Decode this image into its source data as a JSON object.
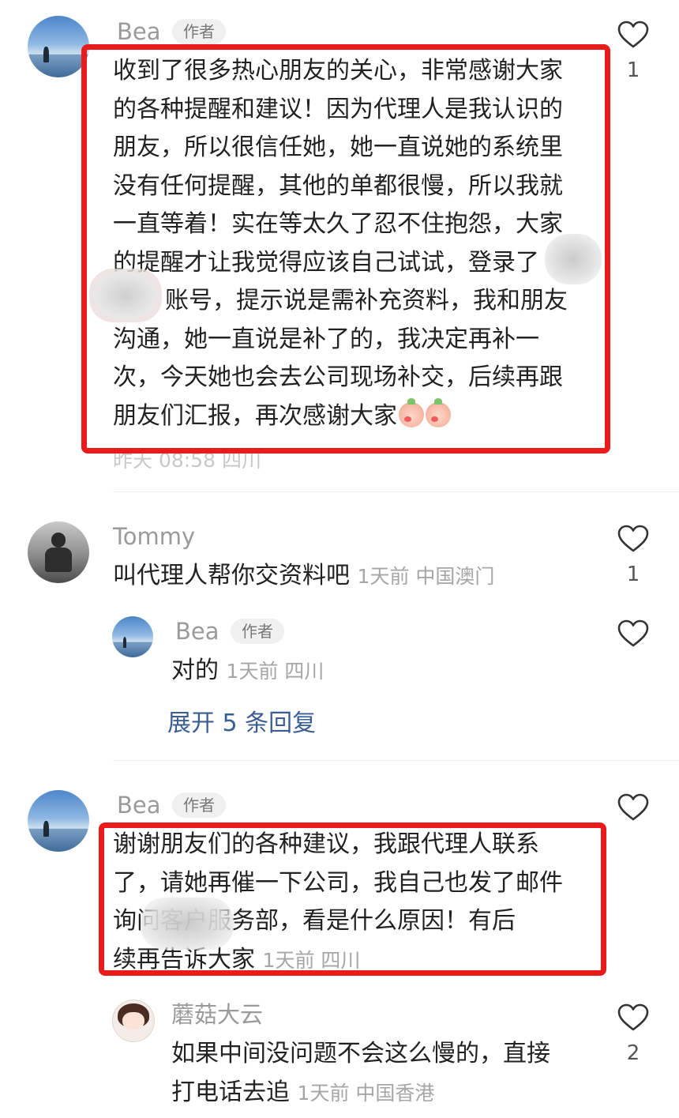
{
  "comments": [
    {
      "user": "Bea",
      "tag": "作者",
      "lines": [
        "收到了很多热心朋友的关心，非常感谢大家",
        "的各种提醒和建议！因为代理人是我认识的",
        "朋友，所以很信任她，她一直说她的系统里",
        "没有任何提醒，其他的单都很慢，所以我就",
        "一直等着！实在等太久了忍不住抱怨，大家",
        "的提醒才让我觉得应该自己试试，登录了",
        "账号，提示说是需补充资料，我和朋友",
        "沟通，她一直说是补了的，我决定再补一",
        "次，今天她也会去公司现场补交，后续再跟",
        "朋友们汇报，再次感谢大家"
      ],
      "meta": "昨天 08:58 四川",
      "likes": "1",
      "emoji": [
        "blush-peach-emoji",
        "blush-peach-emoji"
      ]
    },
    {
      "user": "Tommy",
      "text": "叫代理人帮你交资料吧",
      "meta": "1天前 中国澳门",
      "likes": "1",
      "reply": {
        "user": "Bea",
        "tag": "作者",
        "text": "对的",
        "meta": "1天前 四川"
      },
      "expand_label": "展开 5 条回复"
    },
    {
      "user": "Bea",
      "tag": "作者",
      "lines": [
        "谢谢朋友们的各种建议，我跟代理人联系",
        "了，请她再催一下公司，我自己也发了邮件",
        "询问客户服务部，看是什么原因！有后",
        "续再告诉大家"
      ],
      "meta": "1天前 四川"
    },
    {
      "user": "蘑菇大云",
      "lines": [
        "如果中间没问题不会这么慢的，直接",
        "打电话去追"
      ],
      "meta": "1天前 中国香港",
      "likes": "2"
    }
  ],
  "colors": {
    "highlight_box": "#ea1b1b",
    "link": "#3a5e92",
    "meta_text": "#a6a6a6"
  }
}
